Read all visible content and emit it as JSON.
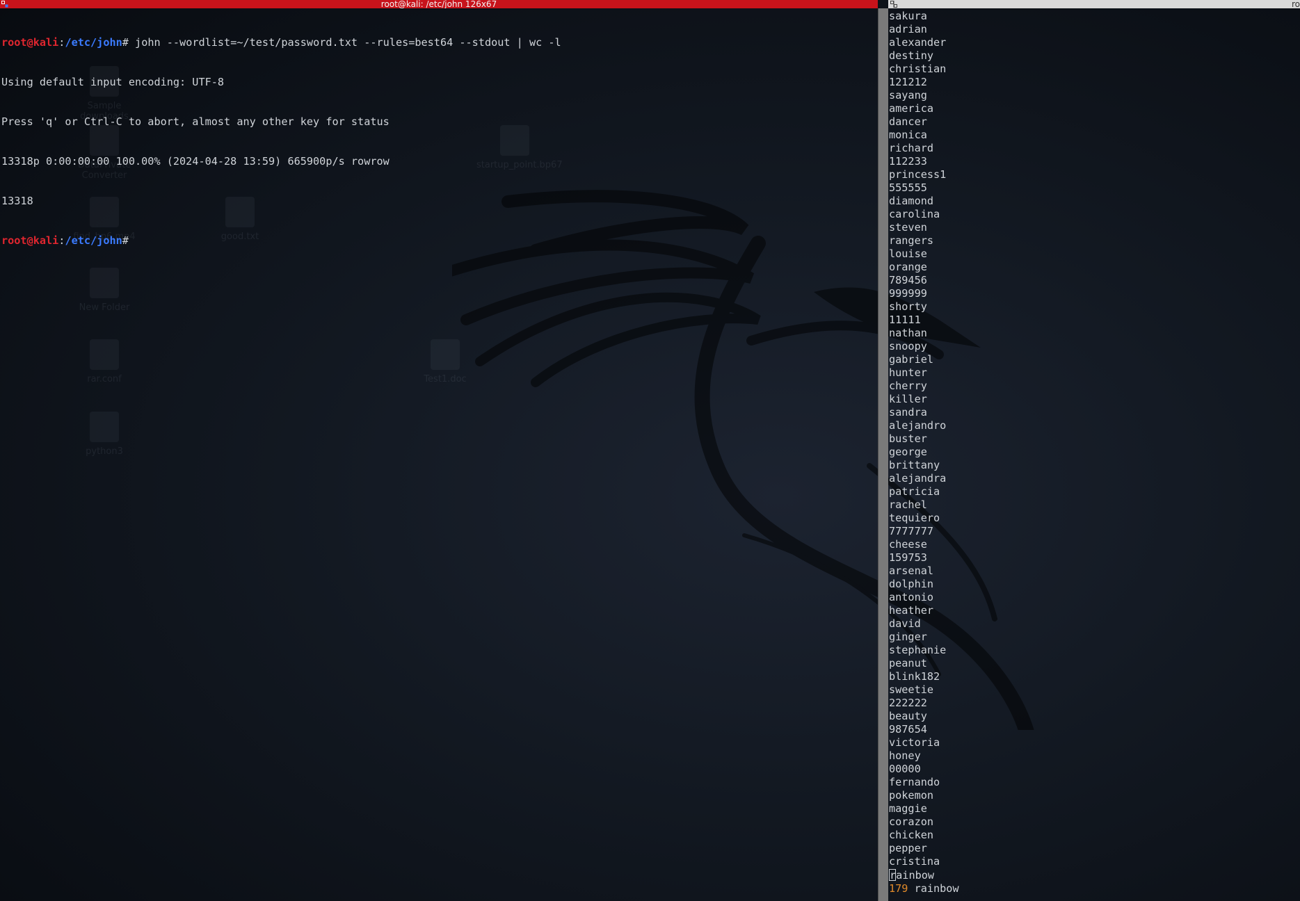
{
  "left_terminal": {
    "title": "root@kali: /etc/john 126x67",
    "lines": [
      {
        "type": "prompt",
        "user": "root@kali",
        "sep": ":",
        "path": "/etc/john",
        "hash": "#",
        "command": " john --wordlist=~/test/password.txt --rules=best64 --stdout | wc -l"
      },
      {
        "type": "output",
        "text": "Using default input encoding: UTF-8"
      },
      {
        "type": "output",
        "text": "Press 'q' or Ctrl-C to abort, almost any other key for status"
      },
      {
        "type": "output",
        "text": "13318p 0:00:00:00 100.00% (2024-04-28 13:59) 665900p/s rowrow"
      },
      {
        "type": "output",
        "text": "13318"
      },
      {
        "type": "prompt",
        "user": "root@kali",
        "sep": ":",
        "path": "/etc/john",
        "hash": "#",
        "command": ""
      }
    ]
  },
  "right_terminal": {
    "title": "ro",
    "words": [
      "sakura",
      "adrian",
      "alexander",
      "destiny",
      "christian",
      "121212",
      "sayang",
      "america",
      "dancer",
      "monica",
      "richard",
      "112233",
      "princess1",
      "555555",
      "diamond",
      "carolina",
      "steven",
      "rangers",
      "louise",
      "orange",
      "789456",
      "999999",
      "shorty",
      "11111",
      "nathan",
      "snoopy",
      "gabriel",
      "hunter",
      "cherry",
      "killer",
      "sandra",
      "alejandro",
      "buster",
      "george",
      "brittany",
      "alejandra",
      "patricia",
      "rachel",
      "tequiero",
      "7777777",
      "cheese",
      "159753",
      "arsenal",
      "dolphin",
      "antonio",
      "heather",
      "david",
      "ginger",
      "stephanie",
      "peanut",
      "blink182",
      "sweetie",
      "222222",
      "beauty",
      "987654",
      "victoria",
      "honey",
      "00000",
      "fernando",
      "pokemon",
      "maggie",
      "corazon",
      "chicken",
      "pepper",
      "cristina"
    ],
    "cursor_line": {
      "cursor_char": "r",
      "rest": "ainbow"
    },
    "status": {
      "count": "179",
      "word": " rainbow"
    }
  },
  "desktop": {
    "icons": [
      {
        "name": "desktop-icon-downloads",
        "label": "Sample downloads"
      },
      {
        "name": "desktop-icon-settings",
        "label": "DataPrivate Converter"
      },
      {
        "name": "desktop-icon-file",
        "label": "find_bp6.mp4"
      },
      {
        "name": "desktop-icon-zip",
        "label": "good.txt"
      },
      {
        "name": "desktop-icon-folder",
        "label": "New Folder"
      },
      {
        "name": "desktop-icon-doc",
        "label": "rar.conf"
      },
      {
        "name": "desktop-icon-folder2",
        "label": "python3"
      },
      {
        "name": "desktop-icon-startup",
        "label": "startup_point.bp67"
      },
      {
        "name": "desktop-icon-word",
        "label": "Test1.doc"
      }
    ]
  },
  "colors": {
    "titlebar_active": "#c8131b",
    "prompt_user": "#e0262f",
    "prompt_path": "#3b7bff",
    "terminal_text": "#d0d4d9",
    "status_count": "#e08a2a"
  }
}
